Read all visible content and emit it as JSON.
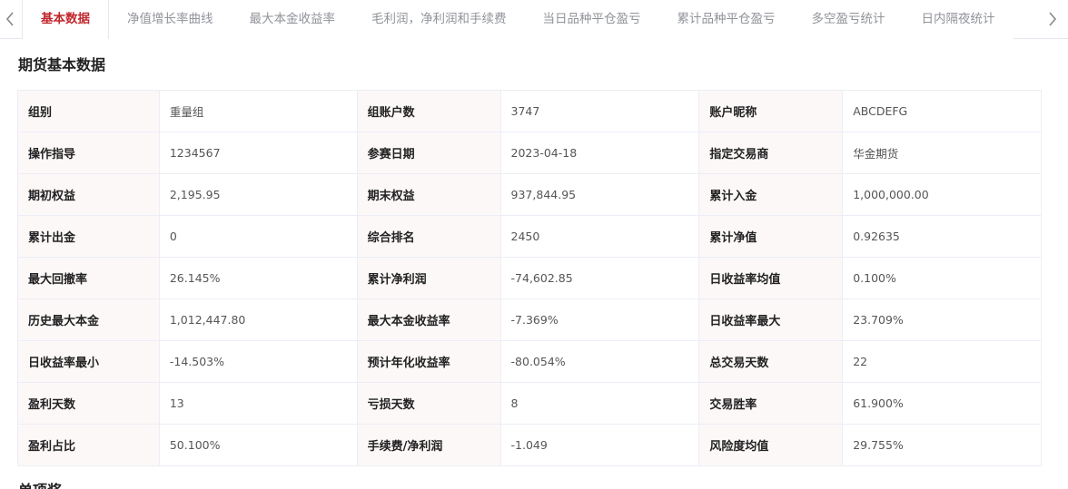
{
  "tabs": [
    {
      "label": "基本数据",
      "active": true
    },
    {
      "label": "净值增长率曲线",
      "active": false
    },
    {
      "label": "最大本金收益率",
      "active": false
    },
    {
      "label": "毛利润，净利润和手续费",
      "active": false
    },
    {
      "label": "当日品种平仓盈亏",
      "active": false
    },
    {
      "label": "累计品种平仓盈亏",
      "active": false
    },
    {
      "label": "多空盈亏统计",
      "active": false
    },
    {
      "label": "日内隔夜统计",
      "active": false
    }
  ],
  "icons": {
    "prev": "chevron-left-icon",
    "next": "chevron-right-icon"
  },
  "colors": {
    "accent": "#c0272d",
    "label_bg": "#fdf8f8",
    "border": "#ebeef5"
  },
  "section_title": "期货基本数据",
  "rows": [
    [
      {
        "label": "组别",
        "value": "重量组"
      },
      {
        "label": "组账户数",
        "value": "3747"
      },
      {
        "label": "账户昵称",
        "value": "ABCDEFG"
      }
    ],
    [
      {
        "label": "操作指导",
        "value": "1234567"
      },
      {
        "label": "参赛日期",
        "value": "2023-04-18"
      },
      {
        "label": "指定交易商",
        "value": "华金期货"
      }
    ],
    [
      {
        "label": "期初权益",
        "value": "2,195.95"
      },
      {
        "label": "期末权益",
        "value": "937,844.95"
      },
      {
        "label": "累计入金",
        "value": "1,000,000.00"
      }
    ],
    [
      {
        "label": "累计出金",
        "value": "0"
      },
      {
        "label": "综合排名",
        "value": "2450"
      },
      {
        "label": "累计净值",
        "value": "0.92635"
      }
    ],
    [
      {
        "label": "最大回撤率",
        "value": "26.145%"
      },
      {
        "label": "累计净利润",
        "value": "-74,602.85"
      },
      {
        "label": "日收益率均值",
        "value": "0.100%"
      }
    ],
    [
      {
        "label": "历史最大本金",
        "value": "1,012,447.80"
      },
      {
        "label": "最大本金收益率",
        "value": "-7.369%"
      },
      {
        "label": "日收益率最大",
        "value": "23.709%"
      }
    ],
    [
      {
        "label": "日收益率最小",
        "value": "-14.503%"
      },
      {
        "label": "预计年化收益率",
        "value": "-80.054%"
      },
      {
        "label": "总交易天数",
        "value": "22"
      }
    ],
    [
      {
        "label": "盈利天数",
        "value": "13"
      },
      {
        "label": "亏损天数",
        "value": "8"
      },
      {
        "label": "交易胜率",
        "value": "61.900%"
      }
    ],
    [
      {
        "label": "盈利占比",
        "value": "50.100%"
      },
      {
        "label": "手续费/净利润",
        "value": "-1.049"
      },
      {
        "label": "风险度均值",
        "value": "29.755%"
      }
    ]
  ],
  "next_section_title": "单项奖"
}
